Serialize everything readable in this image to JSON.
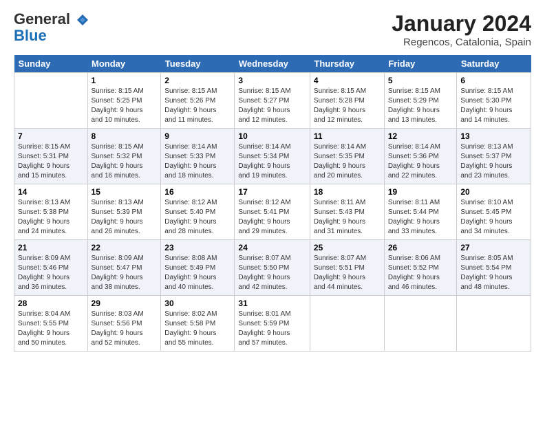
{
  "header": {
    "logo_line1": "General",
    "logo_line2": "Blue",
    "title": "January 2024",
    "subtitle": "Regencos, Catalonia, Spain"
  },
  "weekdays": [
    "Sunday",
    "Monday",
    "Tuesday",
    "Wednesday",
    "Thursday",
    "Friday",
    "Saturday"
  ],
  "weeks": [
    [
      {
        "day": "",
        "info": ""
      },
      {
        "day": "1",
        "info": "Sunrise: 8:15 AM\nSunset: 5:25 PM\nDaylight: 9 hours\nand 10 minutes."
      },
      {
        "day": "2",
        "info": "Sunrise: 8:15 AM\nSunset: 5:26 PM\nDaylight: 9 hours\nand 11 minutes."
      },
      {
        "day": "3",
        "info": "Sunrise: 8:15 AM\nSunset: 5:27 PM\nDaylight: 9 hours\nand 12 minutes."
      },
      {
        "day": "4",
        "info": "Sunrise: 8:15 AM\nSunset: 5:28 PM\nDaylight: 9 hours\nand 12 minutes."
      },
      {
        "day": "5",
        "info": "Sunrise: 8:15 AM\nSunset: 5:29 PM\nDaylight: 9 hours\nand 13 minutes."
      },
      {
        "day": "6",
        "info": "Sunrise: 8:15 AM\nSunset: 5:30 PM\nDaylight: 9 hours\nand 14 minutes."
      }
    ],
    [
      {
        "day": "7",
        "info": "Sunrise: 8:15 AM\nSunset: 5:31 PM\nDaylight: 9 hours\nand 15 minutes."
      },
      {
        "day": "8",
        "info": "Sunrise: 8:15 AM\nSunset: 5:32 PM\nDaylight: 9 hours\nand 16 minutes."
      },
      {
        "day": "9",
        "info": "Sunrise: 8:14 AM\nSunset: 5:33 PM\nDaylight: 9 hours\nand 18 minutes."
      },
      {
        "day": "10",
        "info": "Sunrise: 8:14 AM\nSunset: 5:34 PM\nDaylight: 9 hours\nand 19 minutes."
      },
      {
        "day": "11",
        "info": "Sunrise: 8:14 AM\nSunset: 5:35 PM\nDaylight: 9 hours\nand 20 minutes."
      },
      {
        "day": "12",
        "info": "Sunrise: 8:14 AM\nSunset: 5:36 PM\nDaylight: 9 hours\nand 22 minutes."
      },
      {
        "day": "13",
        "info": "Sunrise: 8:13 AM\nSunset: 5:37 PM\nDaylight: 9 hours\nand 23 minutes."
      }
    ],
    [
      {
        "day": "14",
        "info": "Sunrise: 8:13 AM\nSunset: 5:38 PM\nDaylight: 9 hours\nand 24 minutes."
      },
      {
        "day": "15",
        "info": "Sunrise: 8:13 AM\nSunset: 5:39 PM\nDaylight: 9 hours\nand 26 minutes."
      },
      {
        "day": "16",
        "info": "Sunrise: 8:12 AM\nSunset: 5:40 PM\nDaylight: 9 hours\nand 28 minutes."
      },
      {
        "day": "17",
        "info": "Sunrise: 8:12 AM\nSunset: 5:41 PM\nDaylight: 9 hours\nand 29 minutes."
      },
      {
        "day": "18",
        "info": "Sunrise: 8:11 AM\nSunset: 5:43 PM\nDaylight: 9 hours\nand 31 minutes."
      },
      {
        "day": "19",
        "info": "Sunrise: 8:11 AM\nSunset: 5:44 PM\nDaylight: 9 hours\nand 33 minutes."
      },
      {
        "day": "20",
        "info": "Sunrise: 8:10 AM\nSunset: 5:45 PM\nDaylight: 9 hours\nand 34 minutes."
      }
    ],
    [
      {
        "day": "21",
        "info": "Sunrise: 8:09 AM\nSunset: 5:46 PM\nDaylight: 9 hours\nand 36 minutes."
      },
      {
        "day": "22",
        "info": "Sunrise: 8:09 AM\nSunset: 5:47 PM\nDaylight: 9 hours\nand 38 minutes."
      },
      {
        "day": "23",
        "info": "Sunrise: 8:08 AM\nSunset: 5:49 PM\nDaylight: 9 hours\nand 40 minutes."
      },
      {
        "day": "24",
        "info": "Sunrise: 8:07 AM\nSunset: 5:50 PM\nDaylight: 9 hours\nand 42 minutes."
      },
      {
        "day": "25",
        "info": "Sunrise: 8:07 AM\nSunset: 5:51 PM\nDaylight: 9 hours\nand 44 minutes."
      },
      {
        "day": "26",
        "info": "Sunrise: 8:06 AM\nSunset: 5:52 PM\nDaylight: 9 hours\nand 46 minutes."
      },
      {
        "day": "27",
        "info": "Sunrise: 8:05 AM\nSunset: 5:54 PM\nDaylight: 9 hours\nand 48 minutes."
      }
    ],
    [
      {
        "day": "28",
        "info": "Sunrise: 8:04 AM\nSunset: 5:55 PM\nDaylight: 9 hours\nand 50 minutes."
      },
      {
        "day": "29",
        "info": "Sunrise: 8:03 AM\nSunset: 5:56 PM\nDaylight: 9 hours\nand 52 minutes."
      },
      {
        "day": "30",
        "info": "Sunrise: 8:02 AM\nSunset: 5:58 PM\nDaylight: 9 hours\nand 55 minutes."
      },
      {
        "day": "31",
        "info": "Sunrise: 8:01 AM\nSunset: 5:59 PM\nDaylight: 9 hours\nand 57 minutes."
      },
      {
        "day": "",
        "info": ""
      },
      {
        "day": "",
        "info": ""
      },
      {
        "day": "",
        "info": ""
      }
    ]
  ]
}
